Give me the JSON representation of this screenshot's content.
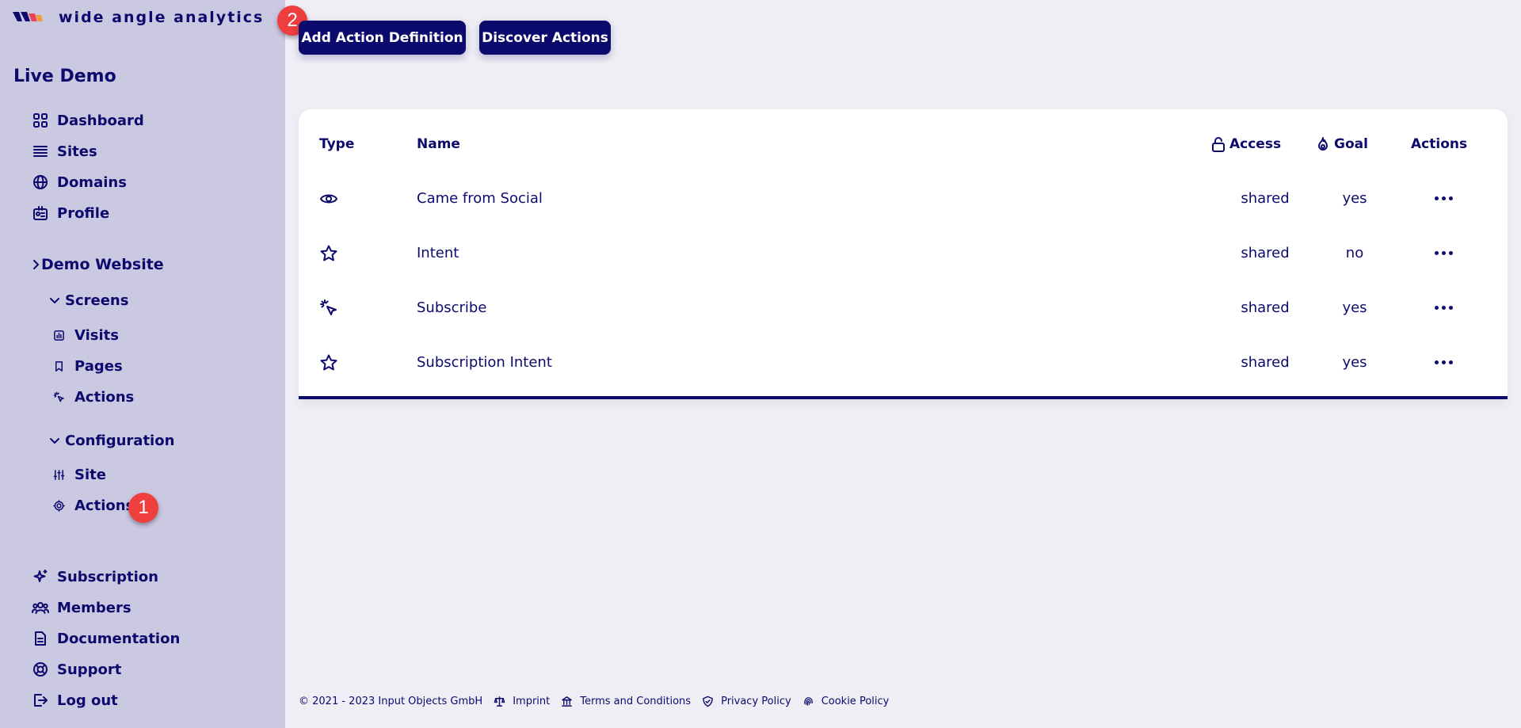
{
  "brand": {
    "name": "wide angle analytics"
  },
  "organization": {
    "title": "Live Demo"
  },
  "sidebar": {
    "main_items": [
      {
        "label": "Dashboard",
        "icon": "dashboard-icon"
      },
      {
        "label": "Sites",
        "icon": "list-icon"
      },
      {
        "label": "Domains",
        "icon": "globe-icon"
      },
      {
        "label": "Profile",
        "icon": "id-card-icon"
      }
    ],
    "website": {
      "label": "Demo Website"
    },
    "screens": {
      "label": "Screens",
      "items": [
        {
          "label": "Visits",
          "icon": "chart-icon"
        },
        {
          "label": "Pages",
          "icon": "bookmark-icon"
        },
        {
          "label": "Actions",
          "icon": "click-icon"
        }
      ]
    },
    "configuration": {
      "label": "Configuration",
      "items": [
        {
          "label": "Site",
          "icon": "sliders-icon"
        },
        {
          "label": "Actions",
          "icon": "cog-icon"
        }
      ]
    },
    "bottom_items": [
      {
        "label": "Subscription",
        "icon": "sparkle-icon"
      },
      {
        "label": "Members",
        "icon": "users-icon"
      },
      {
        "label": "Documentation",
        "icon": "document-icon"
      },
      {
        "label": "Support",
        "icon": "lifebuoy-icon"
      },
      {
        "label": "Log out",
        "icon": "logout-icon"
      }
    ]
  },
  "badges": {
    "step1": "1",
    "step2": "2"
  },
  "toolbar": {
    "add_label": "Add Action Definition",
    "discover_label": "Discover Actions"
  },
  "table": {
    "headers": {
      "type": "Type",
      "name": "Name",
      "access": "Access",
      "goal": "Goal",
      "actions": "Actions"
    },
    "rows": [
      {
        "type_icon": "eye-icon",
        "name": "Came from Social",
        "access": "shared",
        "goal": "yes"
      },
      {
        "type_icon": "star-icon",
        "name": "Intent",
        "access": "shared",
        "goal": "no"
      },
      {
        "type_icon": "click-icon",
        "name": "Subscribe",
        "access": "shared",
        "goal": "yes"
      },
      {
        "type_icon": "star-icon",
        "name": "Subscription Intent",
        "access": "shared",
        "goal": "yes"
      }
    ]
  },
  "footer": {
    "copyright": "© 2021 - 2023 Input Objects GmbH",
    "links": [
      "Imprint",
      "Terms and Conditions",
      "Privacy Policy",
      "Cookie Policy"
    ]
  },
  "colors": {
    "primary": "#0d0a6e",
    "sidebar_bg": "#cbc8e2",
    "page_bg": "#efeef5",
    "badge": "#ef3e3e"
  }
}
